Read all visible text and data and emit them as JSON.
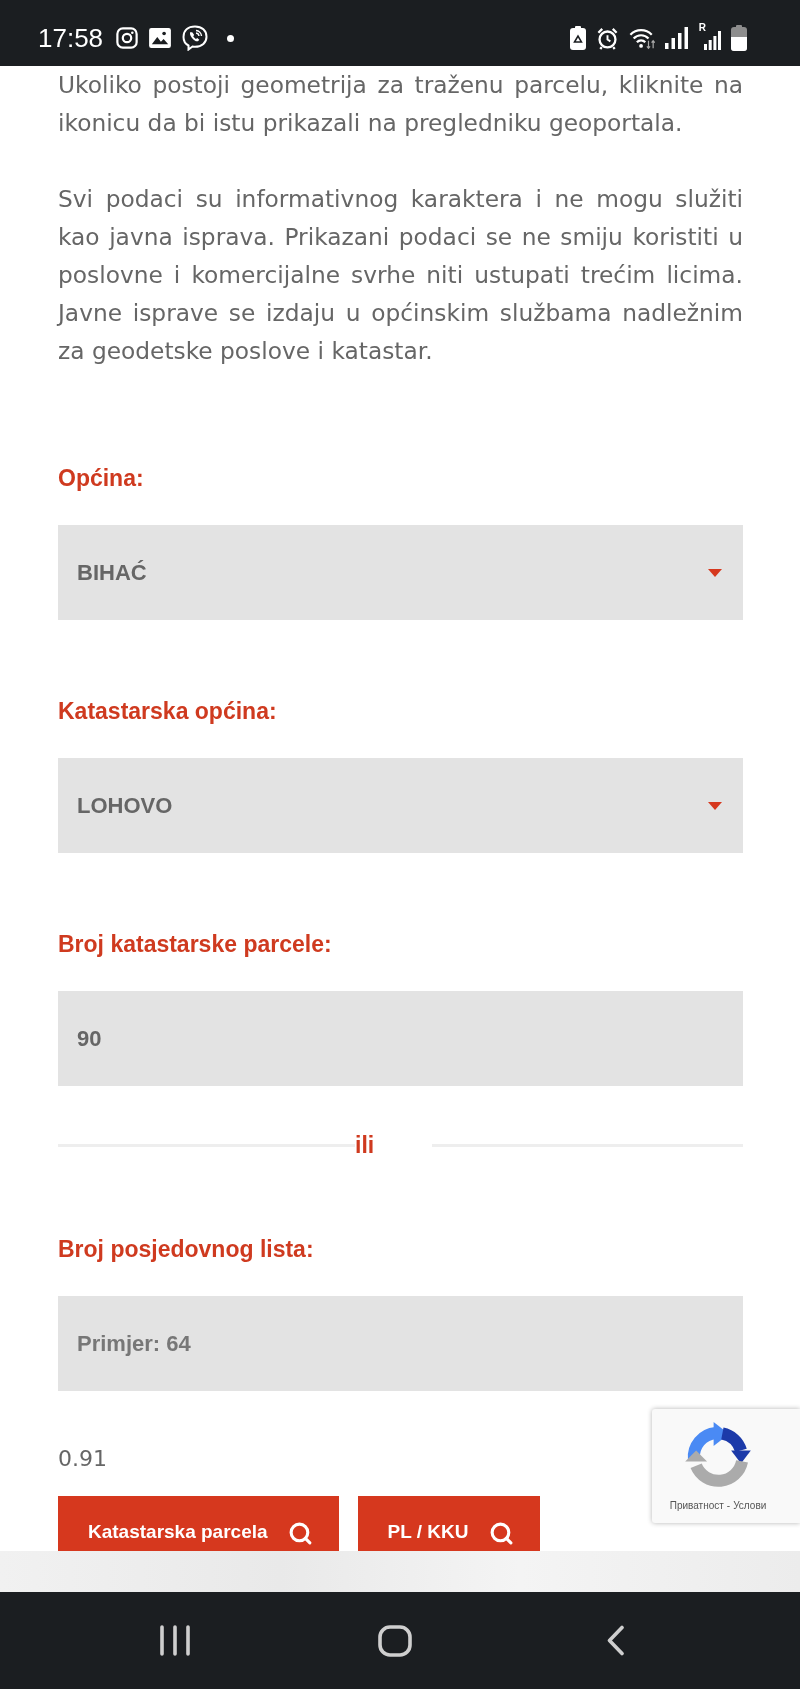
{
  "status_bar": {
    "time": "17:58",
    "roaming_mark": "R"
  },
  "intro": [
    "Ukoliko postoji geometrija za traženu parcelu, kliknite na ikonicu da bi istu prikazali na pregledniku geoportala.",
    "Svi podaci su informativnog karaktera i ne mogu služiti kao javna isprava. Prikazani podaci se ne smiju koristiti u poslovne i komercijalne svrhe niti ustupati trećim licima. Javne isprave se izdaju u općinskim službama nadležnim za geodetske poslove i katastar."
  ],
  "form": {
    "fields": [
      {
        "kind": "select",
        "label": "Općina:",
        "value": "BIHAĆ"
      },
      {
        "kind": "select",
        "label": "Katastarska općina:",
        "value": "LOHOVO"
      },
      {
        "kind": "input",
        "label": "Broj katastarske parcele:",
        "value": "90"
      },
      {
        "kind": "divider",
        "text": "ili"
      },
      {
        "kind": "input",
        "label": "Broj posjedovnog lista:",
        "placeholder": "Primjer: 64"
      }
    ]
  },
  "score": "0.91",
  "buttons": [
    "Katastarska parcela",
    "PL / KKU"
  ],
  "recaptcha": {
    "links": [
      "Приватност",
      "Услови"
    ],
    "separator": "-"
  }
}
